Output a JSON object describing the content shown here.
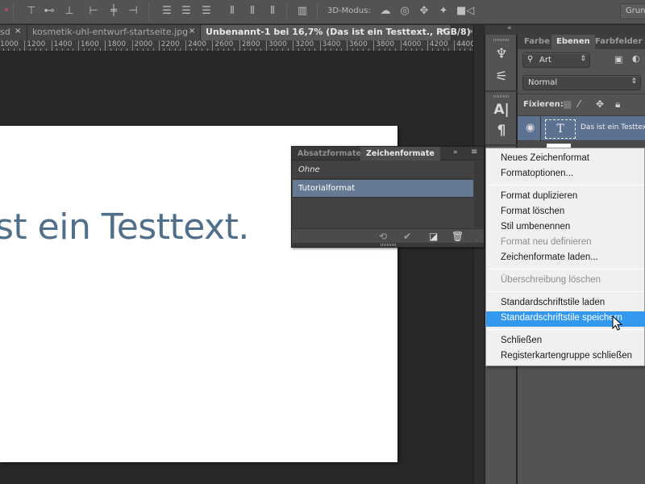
{
  "options_bar": {
    "mode3d_label": "3D-Modus:",
    "workspace_button": "Grun",
    "align_icons": [
      "align-top-edges-icon",
      "align-vertical-centers-icon",
      "align-bottom-edges-icon",
      "align-left-edges-icon",
      "align-horizontal-centers-icon",
      "align-right-edges-icon",
      "distribute-top-icon",
      "distribute-vcenter-icon",
      "distribute-bottom-icon",
      "distribute-left-icon",
      "distribute-hcenter-icon",
      "distribute-right-icon",
      "auto-align-icon"
    ],
    "mode3d_icons": [
      "3d-orbit-icon",
      "3d-roll-icon",
      "3d-pan-icon",
      "3d-slide-icon",
      "3d-scale-icon"
    ]
  },
  "document_tabs": [
    {
      "label": "sd",
      "close": "×",
      "active": false
    },
    {
      "label": "kosmetik-uhl-entwurf-startseite.jpg",
      "close": "×",
      "active": false
    },
    {
      "label": "Unbenannt-1 bei 16,7% (Das ist ein Testtext., RGB/8) *",
      "close": "×",
      "active": true
    }
  ],
  "tab_overflow": "»",
  "ruler": {
    "labels": [
      "1000",
      "1200",
      "1400",
      "1600",
      "1800",
      "2000",
      "2200",
      "2400",
      "2600",
      "2800",
      "3000",
      "3200",
      "3400",
      "3600",
      "3800",
      "4000",
      "4200",
      "4400"
    ]
  },
  "canvas": {
    "text": "st ein Testtext.",
    "text_color": "#4f6f8b"
  },
  "layers_panel": {
    "tabs": [
      "Farbe",
      "Ebenen",
      "Farbfelder"
    ],
    "active_tab": "Ebenen",
    "filter_select": "Art",
    "blend_mode": "Normal",
    "lock_label": "Fixieren:",
    "layers": [
      {
        "name": "Das ist ein Testtext.",
        "type": "text",
        "thumb": "T",
        "selected": true
      },
      {
        "name": "",
        "type": "background",
        "selected": false
      }
    ]
  },
  "char_styles_panel": {
    "tabs": [
      "Absatzformate",
      "Zeichenformate"
    ],
    "active_tab": "Zeichenformate",
    "items": [
      {
        "label": "Ohne",
        "italic": true,
        "selected": false
      },
      {
        "label": "Tutorialformat",
        "italic": false,
        "selected": true
      }
    ],
    "more": "»",
    "menu": "≡"
  },
  "context_menu": {
    "items": [
      {
        "label": "Neues Zeichenformat",
        "disabled": false,
        "highlighted": false
      },
      {
        "label": "Formatoptionen...",
        "disabled": false,
        "highlighted": false
      },
      {
        "sep": true
      },
      {
        "label": "Format duplizieren",
        "disabled": false,
        "highlighted": false
      },
      {
        "label": "Format löschen",
        "disabled": false,
        "highlighted": false
      },
      {
        "label": "Stil umbenennen",
        "disabled": false,
        "highlighted": false
      },
      {
        "label": "Format neu definieren",
        "disabled": true,
        "highlighted": false
      },
      {
        "label": "Zeichenformate laden...",
        "disabled": false,
        "highlighted": false
      },
      {
        "sep": true
      },
      {
        "label": "Überschreibung löschen",
        "disabled": true,
        "highlighted": false
      },
      {
        "sep": true
      },
      {
        "label": "Standardschriftstile laden",
        "disabled": false,
        "highlighted": false
      },
      {
        "label": "Standardschriftstile speichern",
        "disabled": false,
        "highlighted": true
      },
      {
        "sep": true
      },
      {
        "label": "Schließen",
        "disabled": false,
        "highlighted": false
      },
      {
        "label": "Registerkartengruppe schließen",
        "disabled": false,
        "highlighted": false
      }
    ]
  },
  "colors": {
    "selection_blue": "#3399ee",
    "layer_selected": "#5d7190",
    "style_selected": "#667a93"
  }
}
